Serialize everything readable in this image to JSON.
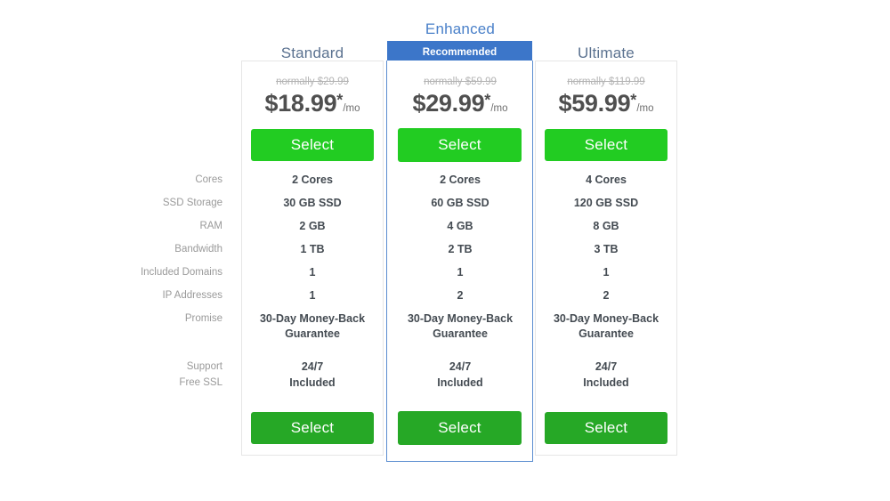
{
  "plans": [
    {
      "key": "standard",
      "title": "Standard",
      "badge": null,
      "normally": "normally $29.99",
      "price": "$18.99",
      "star": "*",
      "per": "/mo",
      "select_top": "Select",
      "select_bottom": "Select",
      "features": [
        "2 Cores",
        "30 GB SSD",
        "2 GB",
        "1 TB",
        "1",
        "1",
        "30-Day Money-Back\nGuarantee",
        "24/7",
        "Included"
      ]
    },
    {
      "key": "enhanced",
      "title": "Enhanced",
      "badge": "Recommended",
      "normally": "normally $59.99",
      "price": "$29.99",
      "star": "*",
      "per": "/mo",
      "select_top": "Select",
      "select_bottom": "Select",
      "features": [
        "2 Cores",
        "60 GB SSD",
        "4 GB",
        "2 TB",
        "1",
        "2",
        "30-Day Money-Back\nGuarantee",
        "24/7",
        "Included"
      ]
    },
    {
      "key": "ultimate",
      "title": "Ultimate",
      "badge": null,
      "normally": "normally $119.99",
      "price": "$59.99",
      "star": "*",
      "per": "/mo",
      "select_top": "Select",
      "select_bottom": "Select",
      "features": [
        "4 Cores",
        "120 GB SSD",
        "8 GB",
        "3 TB",
        "1",
        "2",
        "30-Day Money-Back\nGuarantee",
        "24/7",
        "Included"
      ]
    }
  ],
  "feature_labels": [
    "Cores",
    "SSD Storage",
    "RAM",
    "Bandwidth",
    "Included Domains",
    "IP Addresses",
    "Promise",
    "Support",
    "Free SSL"
  ],
  "colors": {
    "recommended_banner": "#3c76c9",
    "enhanced_title": "#4a80c9",
    "plan_title": "#5b7290",
    "select_top": "#22cc22",
    "select_bottom": "#26a826",
    "feature_label": "#9a9a9a",
    "feature_value": "#444b52",
    "strikethrough": "#b4b4b4",
    "card_border": "#e6e6e6",
    "enhanced_card_border": "#5b8dd0"
  }
}
